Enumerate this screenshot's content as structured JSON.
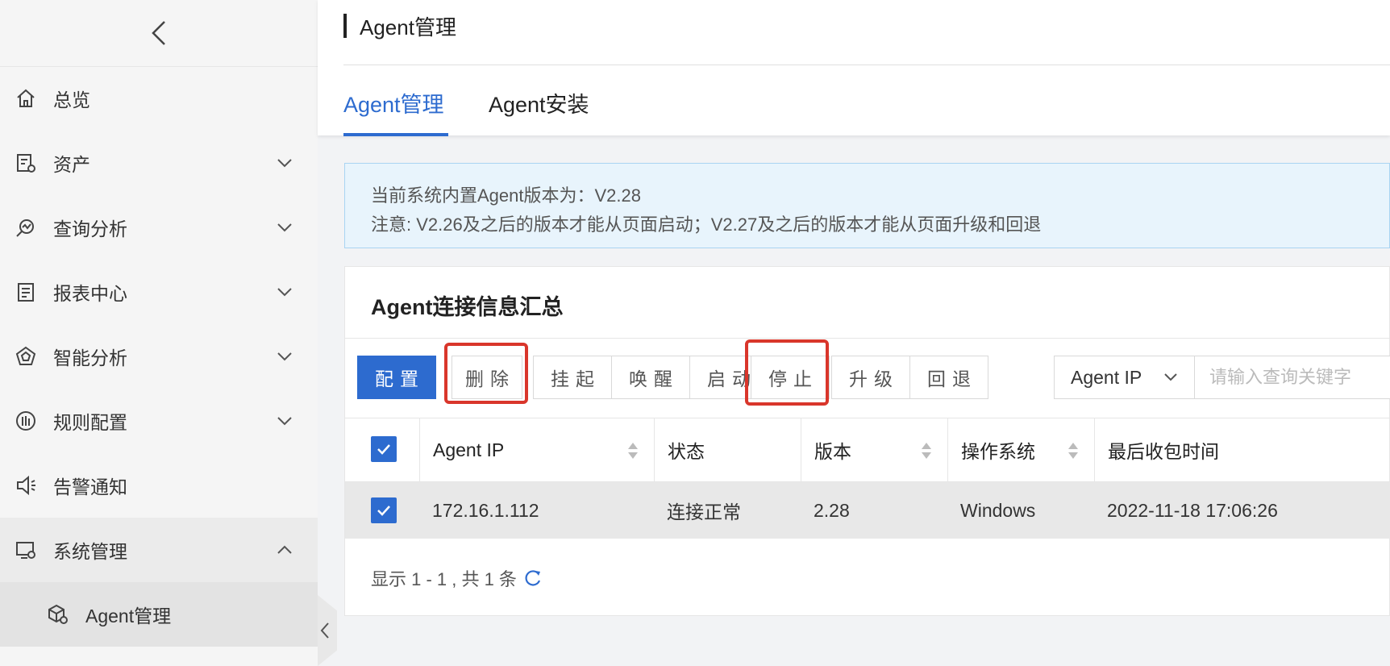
{
  "sidebar": {
    "items": [
      {
        "label": "总览",
        "icon": "home-icon",
        "has_arrow": false
      },
      {
        "label": "资产",
        "icon": "asset-icon",
        "has_arrow": true
      },
      {
        "label": "查询分析",
        "icon": "query-analysis-icon",
        "has_arrow": true
      },
      {
        "label": "报表中心",
        "icon": "report-icon",
        "has_arrow": true
      },
      {
        "label": "智能分析",
        "icon": "intelligent-analysis-icon",
        "has_arrow": true
      },
      {
        "label": "规则配置",
        "icon": "rule-config-icon",
        "has_arrow": true
      },
      {
        "label": "告警通知",
        "icon": "alarm-icon",
        "has_arrow": false
      },
      {
        "label": "系统管理",
        "icon": "system-admin-icon",
        "has_arrow": true,
        "expanded": true
      }
    ],
    "sub_item": {
      "label": "Agent管理",
      "icon": "agent-box-icon"
    }
  },
  "header": {
    "title": "Agent管理",
    "tabs": [
      {
        "label": "Agent管理",
        "active": true
      },
      {
        "label": "Agent安装",
        "active": false
      }
    ]
  },
  "notice": {
    "line1": "当前系统内置Agent版本为：V2.28",
    "line2": "注意: V2.26及之后的版本才能从页面启动；V2.27及之后的版本才能从页面升级和回退"
  },
  "card": {
    "title": "Agent连接信息汇总",
    "buttons": {
      "config": "配置",
      "delete": "删除",
      "suspend": "挂起",
      "wake": "唤醒",
      "start": "启动",
      "stop": "停止",
      "upgrade": "升级",
      "rollback": "回退"
    },
    "filter": {
      "selected": "Agent IP",
      "placeholder": "请输入查询关键字"
    },
    "table": {
      "headers": [
        "Agent IP",
        "状态",
        "版本",
        "操作系统",
        "最后收包时间"
      ],
      "rows": [
        {
          "ip": "172.16.1.112",
          "status": "连接正常",
          "version": "2.28",
          "os": "Windows",
          "last_time": "2022-11-18 17:06:26",
          "checked": true
        }
      ]
    },
    "pagination": "显示 1 - 1 , 共 1 条"
  },
  "colors": {
    "accent": "#2d6bcf",
    "highlight": "#d9362b",
    "notice_bg": "#e8f4fc"
  }
}
